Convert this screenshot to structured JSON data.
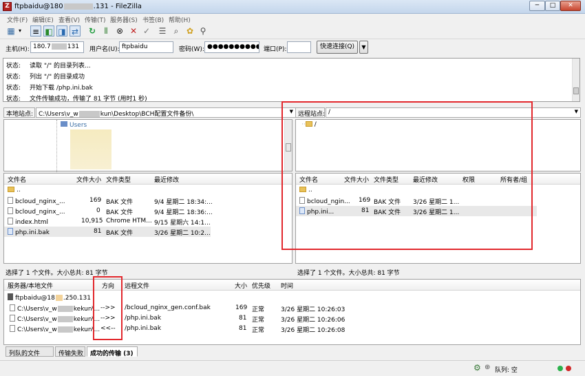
{
  "window": {
    "title_prefix": "ftpbaidu@180",
    "title_suffix": ".131 - FileZilla",
    "app_icon": "Z",
    "min": "─",
    "max": "□",
    "close": "✕"
  },
  "menu": [
    "文件(F)",
    "编辑(E)",
    "查看(V)",
    "传输(T)",
    "服务器(S)",
    "书签(B)",
    "帮助(H)"
  ],
  "toolbar_icons": [
    "site-manager-icon",
    "toggle-log-icon",
    "toggle-local-tree-icon",
    "toggle-remote-tree-icon",
    "toggle-queue-icon",
    "refresh-icon",
    "process-queue-icon",
    "cancel-icon",
    "disconnect-icon",
    "reconnect-icon",
    "filter-icon",
    "compare-icon",
    "sync-browse-icon",
    "find-icon"
  ],
  "quickconnect": {
    "host_label": "主机(H):",
    "host_prefix": "180.7",
    "host_suffix": "131",
    "user_label": "用户名(U):",
    "user": "ftpbaidu",
    "pass_label": "密码(W):",
    "pass": "●●●●●●●●●●",
    "port_label": "端口(P):",
    "port": "",
    "connect": "快速连接(Q)",
    "dropdown": "▼"
  },
  "log": [
    {
      "key": "状态:",
      "msg": "读取 \"/\" 的目录列表..."
    },
    {
      "key": "状态:",
      "msg": "列出 \"/\" 的目录成功"
    },
    {
      "key": "状态:",
      "msg": "开始下载 /php.ini.bak"
    },
    {
      "key": "状态:",
      "msg": "文件传输成功，传输了 81 字节 (用时1 秒)"
    }
  ],
  "local": {
    "site_label": "本地站点:",
    "path_prefix": "C:\\Users\\v_w",
    "path_suffix": "kun\\Desktop\\BCH配置文件备份\\",
    "tree_item": "Users",
    "headers": [
      "文件名",
      "文件大小",
      "文件类型",
      "最近修改"
    ],
    "files": [
      {
        "name": "..",
        "size": "",
        "type": "",
        "modified": "",
        "folder": true
      },
      {
        "name": "bcloud_nginx_...",
        "size": "169",
        "type": "BAK 文件",
        "modified": "9/4 星期二 18:34:..."
      },
      {
        "name": "bcloud_nginx_...",
        "size": "0",
        "type": "BAK 文件",
        "modified": "9/4 星期二 18:36:..."
      },
      {
        "name": "index.html",
        "size": "10,915",
        "type": "Chrome HTM...",
        "modified": "9/15 星期六 14:1..."
      },
      {
        "name": "php.ini.bak",
        "size": "81",
        "type": "BAK 文件",
        "modified": "3/26 星期二 10:2..."
      }
    ],
    "status": "选择了 1 个文件。大小总共: 81 字节"
  },
  "remote": {
    "site_label": "远程站点:",
    "path": "/",
    "tree_item": "/",
    "headers": [
      "文件名",
      "文件大小",
      "文件类型",
      "最近修改",
      "权限",
      "所有者/组"
    ],
    "files": [
      {
        "name": "..",
        "size": "",
        "type": "",
        "modified": "",
        "folder": true
      },
      {
        "name": "bcloud_ngin...",
        "size": "169",
        "type": "BAK 文件",
        "modified": "3/26 星期二 1..."
      },
      {
        "name": "php.ini...",
        "size": "81",
        "type": "BAK 文件",
        "modified": "3/26 星期二 1..."
      }
    ],
    "status": "选择了 1 个文件。大小总共: 81 字节"
  },
  "queue": {
    "headers": [
      "服务器/本地文件",
      "方向",
      "远程文件",
      "大小",
      "优先级",
      "时间"
    ],
    "server_prefix": "ftpbaidu@18",
    "server_suffix": ".250.131",
    "rows": [
      {
        "local_prefix": "C:\\Users\\v_w",
        "local_suffix": "kekun\\...",
        "dir": "-->>",
        "remote": "/bcloud_nginx_gen.conf.bak",
        "size": "169",
        "priority": "正常",
        "time": "3/26 星期二 10:26:03"
      },
      {
        "local_prefix": "C:\\Users\\v_w",
        "local_suffix": "kekun\\...",
        "dir": "-->>",
        "remote": "/php.ini.bak",
        "size": "81",
        "priority": "正常",
        "time": "3/26 星期二 10:26:06"
      },
      {
        "local_prefix": "C:\\Users\\v_w",
        "local_suffix": "kekun\\...",
        "dir": "<<--",
        "remote": "/php.ini.bak",
        "size": "81",
        "priority": "正常",
        "time": "3/26 星期二 10:26:08"
      }
    ]
  },
  "tabs": [
    "列队的文件",
    "传输失败",
    "成功的传输 (3)"
  ],
  "footer": {
    "queue_label": "队列: 空"
  },
  "colors": {
    "highlight_box": "#e2272c",
    "led_green": "#2bb24c",
    "led_red": "#d12a2a"
  }
}
